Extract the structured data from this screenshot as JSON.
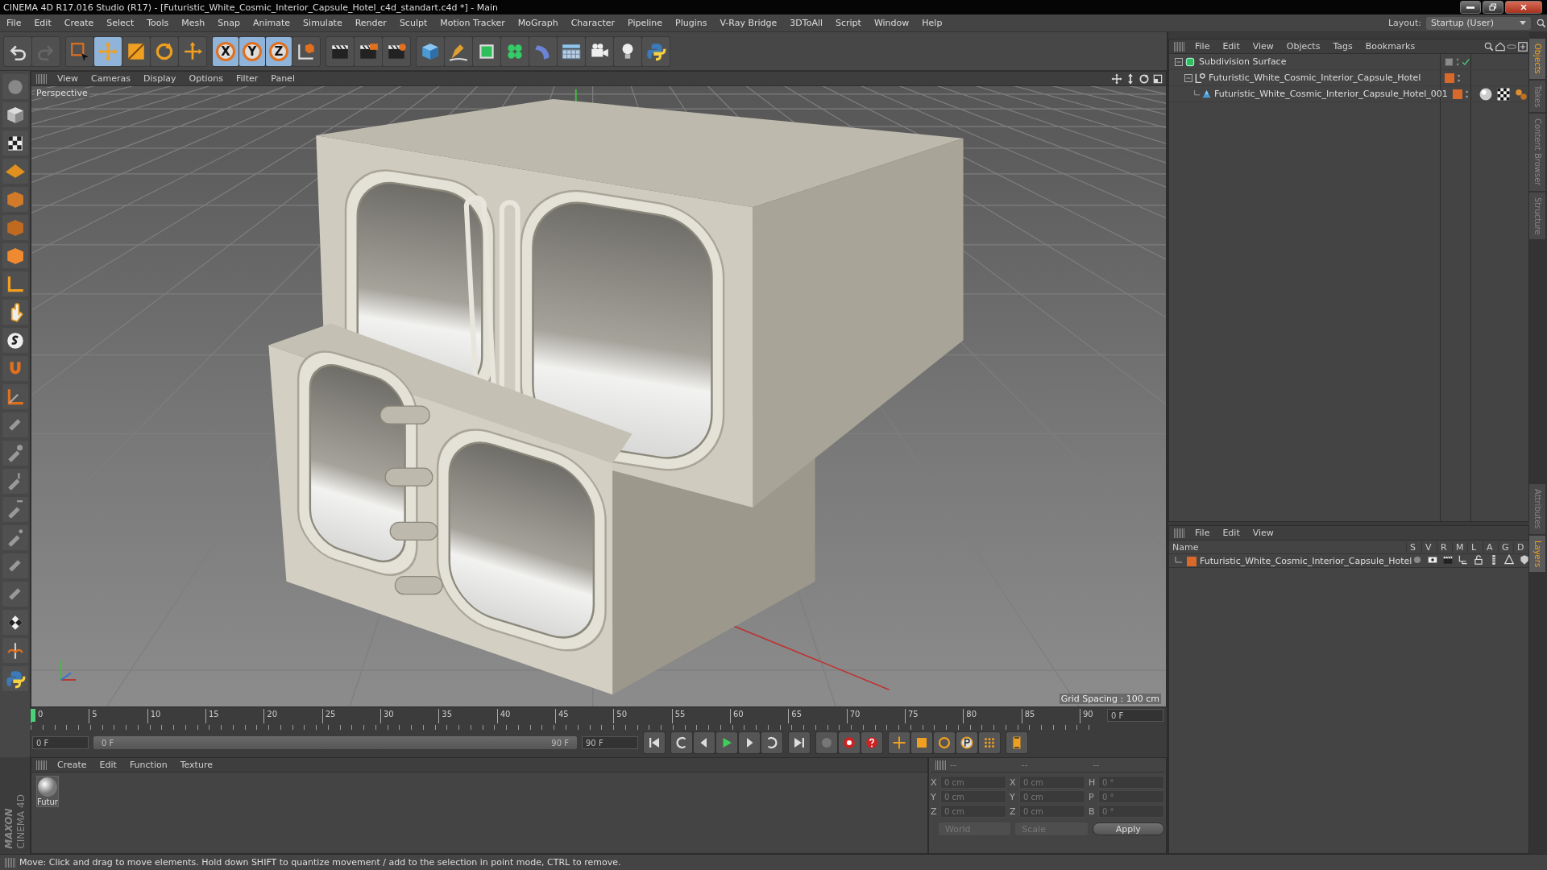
{
  "window": {
    "title": "CINEMA 4D R17.016 Studio (R17) - [Futuristic_White_Cosmic_Interior_Capsule_Hotel_c4d_standart.c4d *] - Main"
  },
  "menu_bar": {
    "items": [
      "File",
      "Edit",
      "Create",
      "Select",
      "Tools",
      "Mesh",
      "Snap",
      "Animate",
      "Simulate",
      "Render",
      "Sculpt",
      "Motion Tracker",
      "MoGraph",
      "Character",
      "Pipeline",
      "Plugins",
      "V-Ray Bridge",
      "3DToAll",
      "Script",
      "Window",
      "Help"
    ],
    "layout_label": "Layout:",
    "layout_value": "Startup (User)"
  },
  "toolbar": {
    "tools": [
      {
        "kind": "select",
        "selected": false
      },
      {
        "kind": "move",
        "selected": true
      },
      {
        "kind": "scale",
        "selected": false
      },
      {
        "kind": "rotate",
        "selected": false
      },
      {
        "kind": "recent",
        "selected": false
      }
    ],
    "axes": [
      {
        "label": "X",
        "active": true
      },
      {
        "label": "Y",
        "active": true
      },
      {
        "label": "Z",
        "active": true
      }
    ]
  },
  "viewport": {
    "menu": [
      "View",
      "Cameras",
      "Display",
      "Options",
      "Filter",
      "Panel"
    ],
    "camera": "Perspective",
    "grid_spacing": "Grid Spacing : 100 cm"
  },
  "timeline": {
    "ticks": [
      "0",
      "5",
      "10",
      "15",
      "20",
      "25",
      "30",
      "35",
      "40",
      "45",
      "50",
      "55",
      "60",
      "65",
      "70",
      "75",
      "80",
      "85",
      "90"
    ],
    "playhead": {
      "level": 0
    },
    "current_frame": "0 F",
    "start_field": "0 F",
    "range": {
      "level": 1
    },
    "range_start": "0 F",
    "range_end": "90 F",
    "end_field": "90 F"
  },
  "material_manager": {
    "menu": [
      "Create",
      "Edit",
      "Function",
      "Texture"
    ],
    "materials": [
      {
        "name": "Futur",
        "selected": false
      }
    ]
  },
  "coordinates": {
    "headers": [
      "--",
      "--",
      "--"
    ],
    "columns": [
      [
        {
          "axis": "X",
          "value": "0 cm"
        },
        {
          "axis": "Y",
          "value": "0 cm"
        },
        {
          "axis": "Z",
          "value": "0 cm"
        }
      ],
      [
        {
          "axis": "X",
          "value": "0 cm"
        },
        {
          "axis": "Y",
          "value": "0 cm"
        },
        {
          "axis": "Z",
          "value": "0 cm"
        }
      ],
      [
        {
          "axis": "H",
          "value": "0 °"
        },
        {
          "axis": "P",
          "value": "0 °"
        },
        {
          "axis": "B",
          "value": "0 °"
        }
      ]
    ],
    "mode": "World",
    "transform": "Scale",
    "apply": "Apply"
  },
  "status_bar": {
    "text": "Move: Click and drag to move elements. Hold down SHIFT to quantize movement / add to the selection in point mode, CTRL to remove."
  },
  "object_manager": {
    "menu": [
      "File",
      "Edit",
      "View",
      "Objects",
      "Tags",
      "Bookmarks"
    ],
    "objects": [
      {
        "name": "Subdivision Surface",
        "kind": "subdivision",
        "enabled": true,
        "expanded": true,
        "children": [
          {
            "name": "Futuristic_White_Cosmic_Interior_Capsule_Hotel",
            "kind": "null",
            "color": "#d9692b",
            "expanded": true,
            "children": [
              {
                "name": "Futuristic_White_Cosmic_Interior_Capsule_Hotel_001",
                "kind": "polygon",
                "color": "#d9692b",
                "tags": [
                  {
                    "kind": "material"
                  },
                  {
                    "kind": "checker"
                  },
                  {
                    "kind": "phong"
                  }
                ]
              }
            ]
          }
        ]
      }
    ]
  },
  "layer_manager": {
    "menu": [
      "File",
      "Edit",
      "View"
    ],
    "name_header": "Name",
    "columns": [
      "S",
      "V",
      "R",
      "M",
      "L",
      "A",
      "G",
      "D"
    ],
    "layers": [
      {
        "name": "Futuristic_White_Cosmic_Interior_Capsule_Hotel",
        "color": "#d9692b"
      }
    ]
  },
  "side_tabs": {
    "top": [
      {
        "label": "Objects",
        "selected": true
      },
      {
        "label": "Takes",
        "selected": false
      },
      {
        "label": "Content Browser",
        "selected": false
      },
      {
        "label": "Structure",
        "selected": false
      }
    ],
    "bottom": [
      {
        "label": "Attributes",
        "selected": false
      },
      {
        "label": "Layers",
        "selected": true
      }
    ]
  },
  "logo": {
    "brand": "MAXON",
    "product": "CINEMA 4D"
  }
}
